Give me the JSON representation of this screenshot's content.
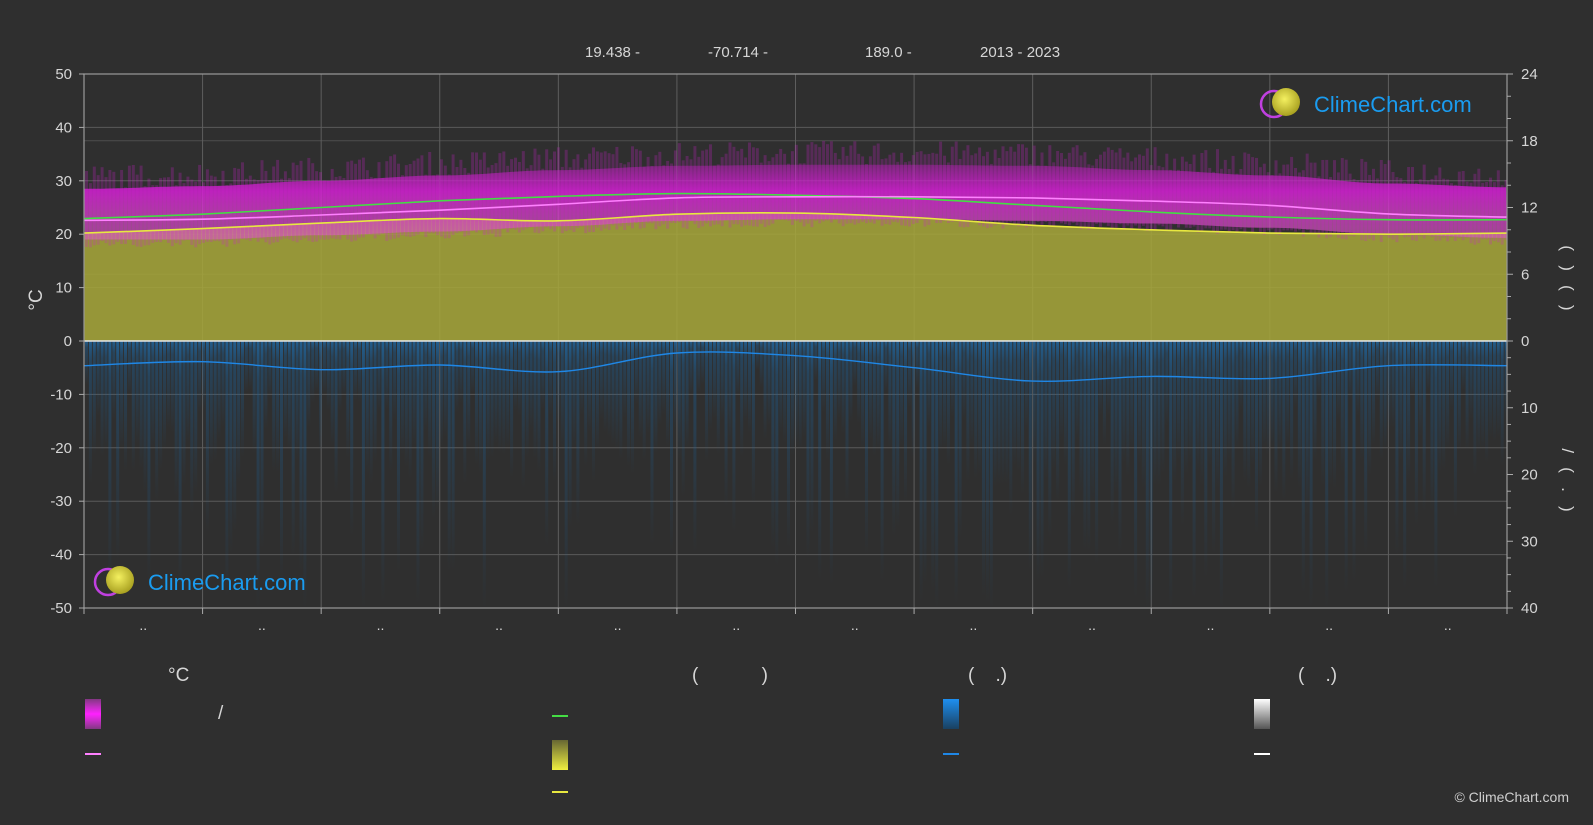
{
  "header": {
    "latitude": "19.438 -",
    "longitude": "-70.714 -",
    "elevation": "189.0 -",
    "period": "2013 - 2023"
  },
  "brand": {
    "name": "ClimeChart.com",
    "copyright": "© ClimeChart.com"
  },
  "legend": {
    "temp_title": "°C",
    "sun_title": "(            )",
    "rain_title": "(    .)",
    "snow_title": "(    .)",
    "temp_range_sep": "/"
  },
  "colors": {
    "background": "#2f2f2f",
    "temp_band": "#d020d0",
    "temp_mean": "#ff80ff",
    "daylight": "#44dd44",
    "sunshine_fill": "#a8a83a",
    "sunshine_line": "#e8e840",
    "rain": "#1f87e6",
    "snow": "#ffffff",
    "brand": "#1a9cf0"
  },
  "chart_data": {
    "type": "line",
    "x_ticks": [
      "..",
      "..",
      "..",
      "..",
      "..",
      "..",
      "..",
      "..",
      "..",
      "..",
      "..",
      ".."
    ],
    "left_axis": {
      "label": "°C",
      "ticks": [
        50,
        40,
        30,
        20,
        10,
        0,
        -10,
        -20,
        -30,
        -40,
        -50
      ],
      "range": [
        -50,
        50
      ]
    },
    "right_axis_top": {
      "ticks": [
        24,
        18,
        12,
        6,
        0
      ],
      "range": [
        0,
        24
      ],
      "label": "(   )   (   )"
    },
    "right_axis_bottom": {
      "ticks": [
        0,
        10,
        20,
        30,
        40
      ],
      "range": [
        0,
        40
      ],
      "label": "/   (   .   )"
    },
    "series": [
      {
        "key": "temp_mean",
        "x": [
          0,
          1,
          2,
          3,
          4,
          5,
          6,
          7,
          8,
          9,
          10,
          11,
          12
        ],
        "values": [
          22.6,
          22.8,
          23.6,
          24.5,
          25.6,
          26.8,
          27.0,
          27.0,
          26.8,
          26.2,
          25.4,
          23.8,
          23.2
        ]
      },
      {
        "key": "temp_max",
        "x": [
          0,
          1,
          2,
          3,
          4,
          5,
          6,
          7,
          8,
          9,
          10,
          11,
          12
        ],
        "values": [
          28.5,
          29.0,
          30.0,
          31.0,
          32.0,
          32.8,
          33.0,
          33.0,
          32.8,
          32.0,
          31.0,
          29.5,
          28.8
        ]
      },
      {
        "key": "temp_min",
        "x": [
          0,
          1,
          2,
          3,
          4,
          5,
          6,
          7,
          8,
          9,
          10,
          11,
          12
        ],
        "values": [
          19.0,
          19.0,
          19.8,
          20.5,
          21.5,
          22.5,
          22.8,
          22.8,
          22.5,
          22.0,
          21.2,
          20.0,
          19.3
        ]
      },
      {
        "key": "daylight",
        "x": [
          0,
          1,
          2,
          3,
          4,
          5,
          6,
          7,
          8,
          9,
          10,
          11,
          12
        ],
        "values": [
          11.0,
          11.4,
          12.0,
          12.6,
          13.0,
          13.25,
          13.1,
          12.8,
          12.2,
          11.6,
          11.15,
          10.9,
          10.9
        ]
      },
      {
        "key": "sunshine",
        "x": [
          0,
          1,
          2,
          3,
          4,
          5,
          6,
          7,
          8,
          9,
          10,
          11,
          12
        ],
        "values": [
          9.7,
          10.1,
          10.6,
          11.0,
          10.8,
          11.4,
          11.5,
          11.1,
          10.4,
          10.0,
          9.7,
          9.6,
          9.7
        ]
      },
      {
        "key": "rain_mean",
        "x": [
          0,
          1,
          2,
          3,
          4,
          5,
          6,
          7,
          8,
          9,
          10,
          11,
          12
        ],
        "values": [
          3.7,
          3.1,
          4.3,
          3.6,
          4.6,
          1.8,
          2.2,
          4.0,
          6.0,
          5.3,
          5.6,
          3.7,
          3.7
        ]
      }
    ]
  }
}
